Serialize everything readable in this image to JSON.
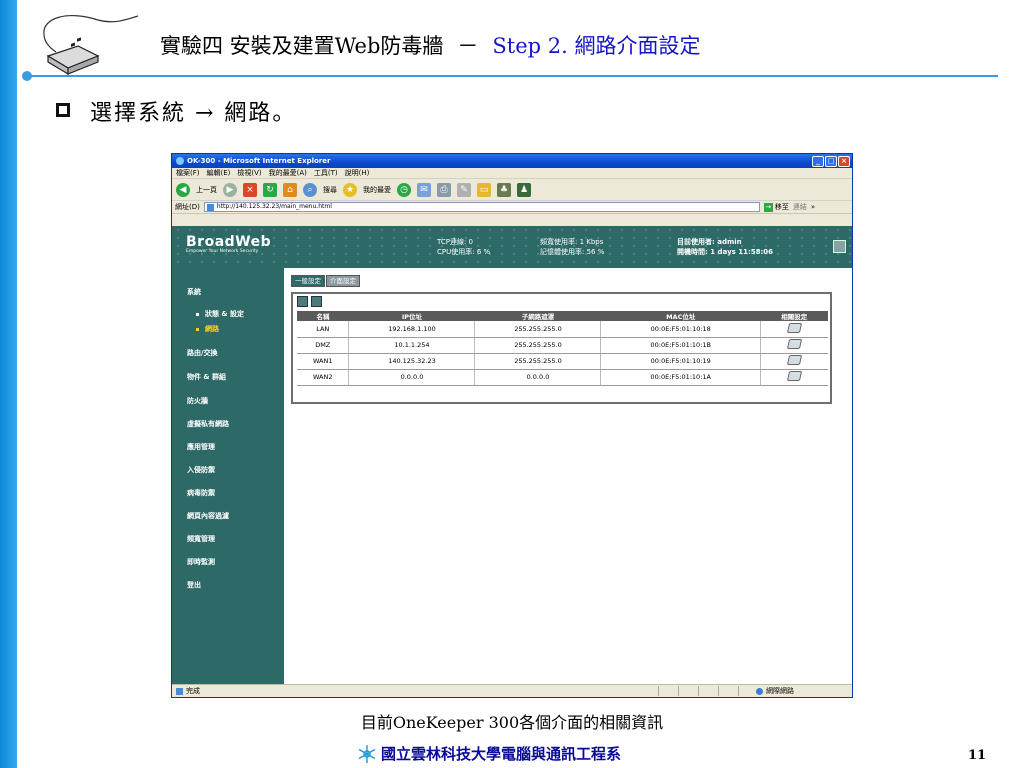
{
  "slide": {
    "title_left": "實驗四 安裝及建置Web防毒牆",
    "title_dash": "－",
    "title_step": "Step 2. 網路介面設定",
    "bullet": "選擇系統 → 網路。",
    "caption": "目前OneKeeper 300各個介面的相關資訊",
    "footer": "國立雲林科技大學電腦與通訊工程系",
    "page_number": "11"
  },
  "colors": {
    "accent_blue": "#0a87d6",
    "step_text": "#1515c8",
    "console_teal": "#2d6a67",
    "active_nav": "#ffd21e"
  },
  "browser": {
    "title": "OK-300 - Microsoft Internet Explorer",
    "menu": [
      "檔案(F)",
      "編輯(E)",
      "檢視(V)",
      "我的最愛(A)",
      "工具(T)",
      "說明(H)"
    ],
    "toolbar": {
      "back": "上一頁",
      "search": "搜尋",
      "favorites": "我的最愛"
    },
    "address_label": "網址(D)",
    "address_value": "http://140.125.32.23/main_menu.html",
    "go_label": "移至",
    "links_label": "連結",
    "status_text": "完成",
    "status_zone": "網際網路"
  },
  "console": {
    "brand": "BroadWeb",
    "tagline": "Empower Your Network Security",
    "stats": {
      "tcp": "TCP連線: 0",
      "cpu": "CPU使用率: 6 %",
      "bandwidth": "頻寬使用率: 1 Kbps",
      "memory": "記憶體使用率: 56 %",
      "user": "目前使用者: admin",
      "uptime": "開機時間: 1 days 11:58:06"
    },
    "nav": {
      "system": "系統",
      "system_status": "狀態 & 設定",
      "system_network": "網路",
      "routing": "路由/交換",
      "objects": "物件 & 群組",
      "firewall": "防火牆",
      "vpn": "虛擬私有網路",
      "app_mgmt": "應用管理",
      "ips": "入侵防禦",
      "antivirus": "病毒防禦",
      "web_filter": "網頁內容過濾",
      "bandwidth": "頻寬管理",
      "monitor": "即時監測",
      "logout": "登出"
    },
    "tabs": {
      "general": "一般設定",
      "interface": "介面設定"
    },
    "table": {
      "headers": [
        "名稱",
        "IP位址",
        "子網路遮罩",
        "MAC位址",
        "相關設定"
      ],
      "rows": [
        [
          "LAN",
          "192.168.1.100",
          "255.255.255.0",
          "00:0E:F5:01:10:18"
        ],
        [
          "DMZ",
          "10.1.1.254",
          "255.255.255.0",
          "00:0E:F5:01:10:1B"
        ],
        [
          "WAN1",
          "140.125.32.23",
          "255.255.255.0",
          "00:0E:F5:01:10:19"
        ],
        [
          "WAN2",
          "0.0.0.0",
          "0.0.0.0",
          "00:0E:F5:01:10:1A"
        ]
      ]
    }
  }
}
